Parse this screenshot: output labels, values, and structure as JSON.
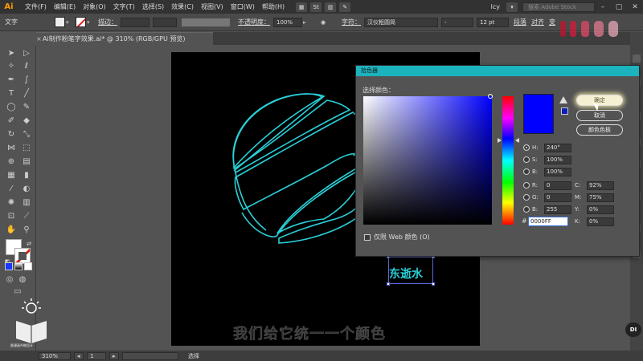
{
  "app": {
    "logo": "Ai",
    "menus": [
      "文件(F)",
      "编辑(E)",
      "对象(O)",
      "文字(T)",
      "选择(S)",
      "效果(C)",
      "视图(V)",
      "窗口(W)",
      "帮助(H)"
    ],
    "user": "lcy",
    "search_placeholder": "搜索 Adobe Stock"
  },
  "control": {
    "selection_label": "文字",
    "stroke_label": "描边：",
    "opacity_label": "不透明度：",
    "opacity_value": "100%",
    "char_label": "字符：",
    "font_name": "汉仪粗圆简",
    "font_style": "-",
    "font_size": "12 pt",
    "paragraph_label": "段落",
    "align_label": "对齐",
    "transform_label": "变"
  },
  "document": {
    "tab_title": "Ai制作粉笔字效果.ai* @ 310% (RGB/GPU 预览)",
    "close_icon": "×"
  },
  "canvas": {
    "sample_text": "东逝水",
    "subtitle": "我们给它统一一个颜色"
  },
  "picker": {
    "title": "拾色器",
    "select_label": "选择颜色：",
    "ok": "确定",
    "cancel": "取消",
    "swatches": "颜色色板",
    "H": {
      "label": "H:",
      "value": "240°"
    },
    "S": {
      "label": "S:",
      "value": "100%"
    },
    "B": {
      "label": "B:",
      "value": "100%"
    },
    "R": {
      "label": "R:",
      "value": "0"
    },
    "G": {
      "label": "G:",
      "value": "0"
    },
    "Bl": {
      "label": "B:",
      "value": "255"
    },
    "C": {
      "label": "C:",
      "value": "92%"
    },
    "M": {
      "label": "M:",
      "value": "75%"
    },
    "Y": {
      "label": "Y:",
      "value": "0%"
    },
    "K": {
      "label": "K:",
      "value": "0%"
    },
    "hex_prefix": "#",
    "hex": "0000FF",
    "web_only": "仅限 Web 颜色 (O)",
    "selected_color": "#0000ff"
  },
  "status": {
    "zoom": "310%",
    "page": "1",
    "tool": "选择"
  },
  "brand": {
    "name": "跟漫画AI做设计"
  },
  "badge": "DI",
  "colors": {
    "accent": "#1bb3bd",
    "art_stroke": "#2ad0d8"
  }
}
